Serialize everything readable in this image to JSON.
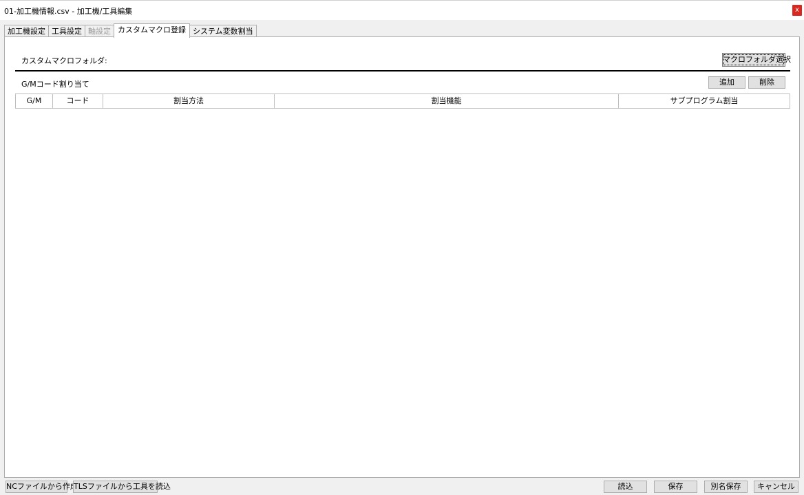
{
  "window": {
    "title": "01-加工機情報.csv - 加工機/工具編集",
    "close_label": "x"
  },
  "tabs": [
    {
      "label": "加工機設定",
      "state": "normal"
    },
    {
      "label": "工具設定",
      "state": "normal"
    },
    {
      "label": "軸設定",
      "state": "disabled"
    },
    {
      "label": "カスタムマクロ登録",
      "state": "active"
    },
    {
      "label": "システム変数割当",
      "state": "normal"
    }
  ],
  "macro_folder": {
    "label": "カスタムマクロフォルダ:",
    "select_button": "マクロフォルダ選択"
  },
  "gm_assign": {
    "label": "G/Mコード割り当て",
    "add_button": "追加",
    "delete_button": "削除",
    "columns": [
      "G/M",
      "コード",
      "割当方法",
      "割当機能",
      "サブプログラム割当"
    ],
    "rows": []
  },
  "footer": {
    "create_from_nc": "NCファイルから作成",
    "load_tools_from_tls": "TLSファイルから工具を読込",
    "load": "読込",
    "save": "保存",
    "save_as": "別名保存",
    "cancel": "キャンセル"
  }
}
